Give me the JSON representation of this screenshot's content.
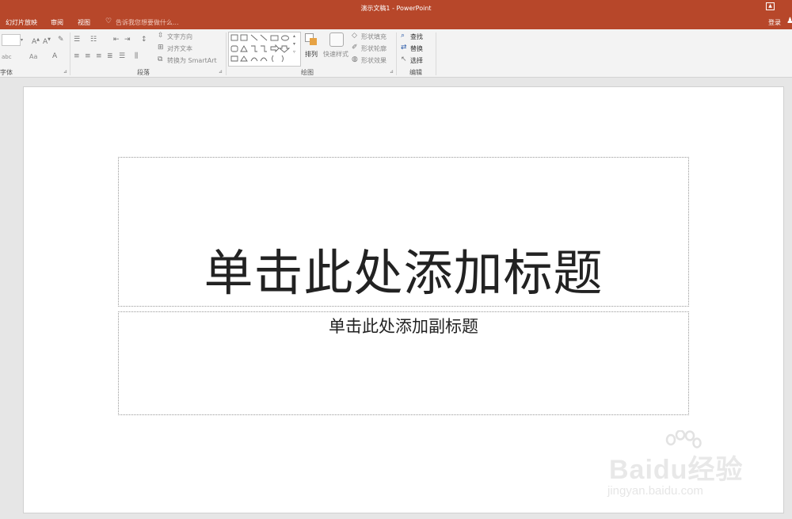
{
  "window": {
    "title": "演示文稿1 - PowerPoint",
    "login": "登录"
  },
  "tabs": [
    {
      "label": "幻灯片放映"
    },
    {
      "label": "审阅"
    },
    {
      "label": "视图"
    }
  ],
  "tell_me": {
    "placeholder": "告诉我您想要做什么..."
  },
  "ribbon": {
    "groups": {
      "font": "字体",
      "paragraph": "段落",
      "drawing": "绘图",
      "editing": "编辑"
    },
    "paragraph": {
      "text_direction": "文字方向",
      "align_text": "对齐文本",
      "convert_smartart": "转换为 SmartArt"
    },
    "drawing": {
      "arrange": "排列",
      "quick_styles": "快速样式",
      "shape_fill": "形状填充",
      "shape_outline": "形状轮廓",
      "shape_effects": "形状效果"
    },
    "editing": {
      "find": "查找",
      "replace": "替换",
      "select": "选择"
    },
    "font": {
      "abc": "abc",
      "aa": "Aa"
    }
  },
  "slide": {
    "title_placeholder": "单击此处添加标题",
    "subtitle_placeholder": "单击此处添加副标题"
  },
  "watermark": {
    "brand": "Baidu经验",
    "url": "jingyan.baidu.com"
  }
}
